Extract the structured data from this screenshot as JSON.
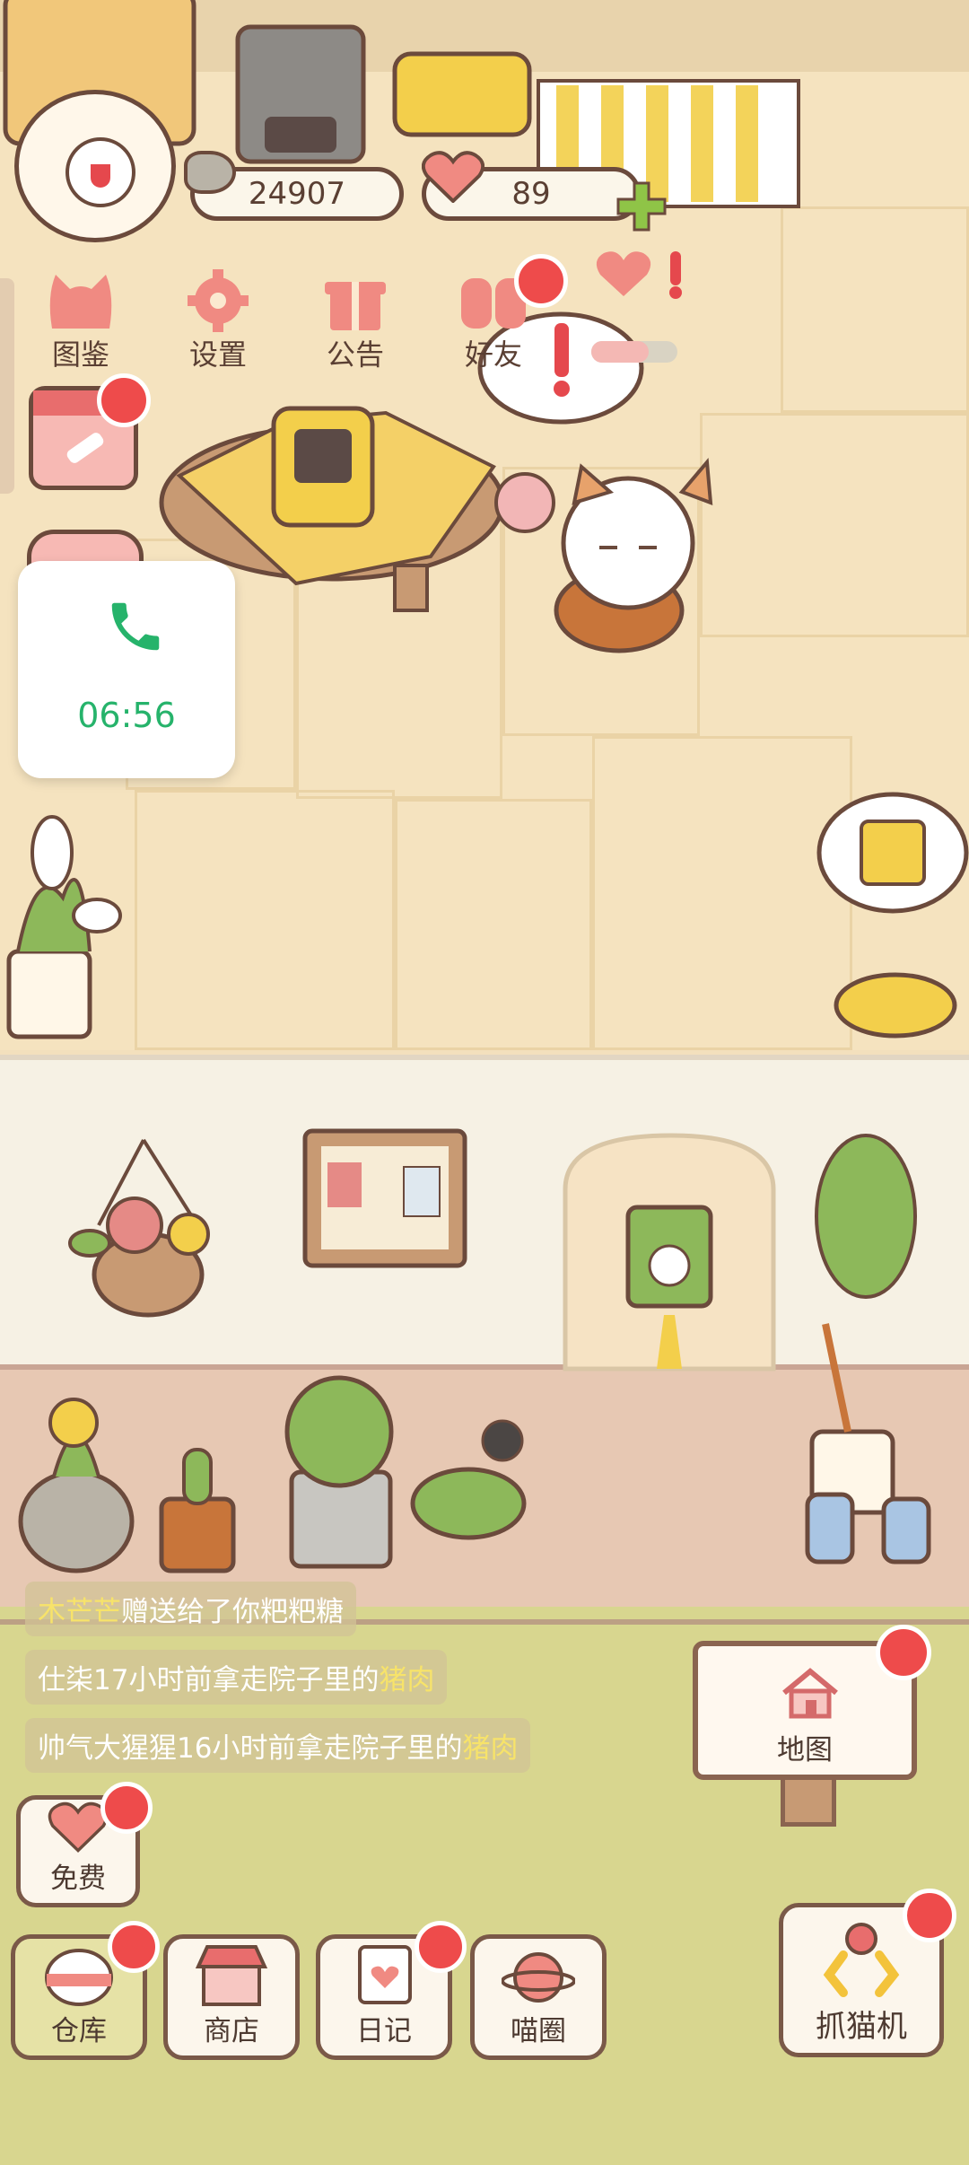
{
  "currency": {
    "fish_count": "24907",
    "heart_count": "89"
  },
  "top_menu": [
    {
      "label": "图鉴",
      "icon": "cat-head-icon"
    },
    {
      "label": "设置",
      "icon": "gear-icon"
    },
    {
      "label": "公告",
      "icon": "gift-icon"
    },
    {
      "label": "好友",
      "icon": "friends-icon"
    }
  ],
  "call_overlay": {
    "time": "06:56",
    "icon": "phone-icon"
  },
  "feed": {
    "line1": {
      "name": "木芒芒",
      "text": "赠送给了你粑粑糖"
    },
    "line2": {
      "text": "仕柒17小时前拿走院子里的",
      "item": "猪肉"
    },
    "line3": {
      "text": "帅气大猩猩16小时前拿走院子里的",
      "item": "猪肉"
    }
  },
  "map_sign": {
    "label": "地图",
    "icon": "house-icon"
  },
  "free_button": {
    "label": "免费",
    "icon": "heart-icon"
  },
  "bottom_nav": [
    {
      "label": "仓库",
      "icon": "rice-ball-icon",
      "badge": true,
      "active": true
    },
    {
      "label": "商店",
      "icon": "shop-icon",
      "badge": false,
      "active": false
    },
    {
      "label": "日记",
      "icon": "diary-icon",
      "badge": true,
      "active": false
    },
    {
      "label": "喵圈",
      "icon": "cat-planet-icon",
      "badge": false,
      "active": false
    }
  ],
  "claw_machine": {
    "label": "抓猫机",
    "icon": "claw-icon"
  },
  "colors": {
    "badge_red": "#ee4b4b",
    "call_green": "#26b36b",
    "outline_brown": "#6b4a3c",
    "highlight_yellow": "#f7e36a"
  }
}
